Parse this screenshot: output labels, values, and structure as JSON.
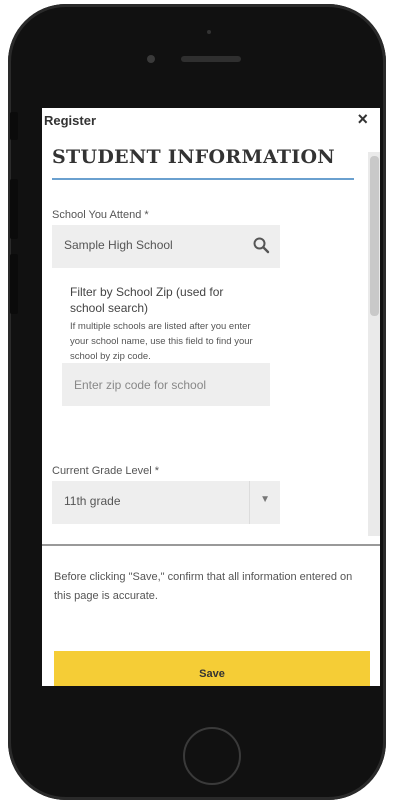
{
  "modal": {
    "title": "Register",
    "close_symbol": "×",
    "heading": "STUDENT INFORMATION"
  },
  "school": {
    "label": "School You Attend",
    "required_mark": "*",
    "value": "Sample High School",
    "icon": "search-icon"
  },
  "zip_filter": {
    "title": "Filter by School Zip (used for school search)",
    "help": "If multiple schools are listed after you enter your school name, use this field to find your school by zip code.",
    "placeholder": "Enter zip code for school"
  },
  "grade": {
    "label": "Current Grade Level",
    "required_mark": "*",
    "value": "11th grade",
    "icon": "chevron-down-icon"
  },
  "footer": {
    "note": "Before clicking \"Save,\" confirm that all information entered on this page is accurate.",
    "save_label": "Save"
  },
  "colors": {
    "save_button": "#f5cd36",
    "heading_rule": "#6aa0cf",
    "field_bg": "#eeeeee",
    "phone_body": "#111111"
  }
}
